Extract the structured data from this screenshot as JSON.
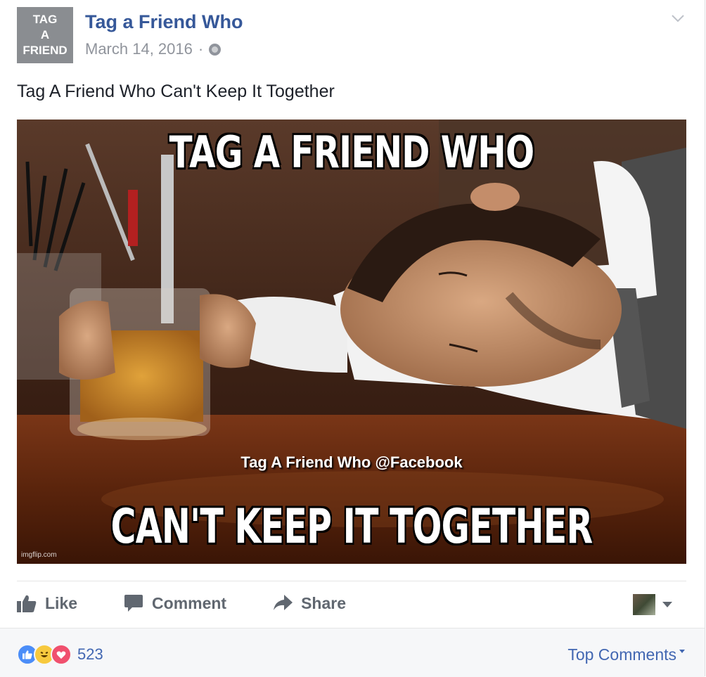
{
  "post": {
    "avatar_lines": [
      "TAG",
      "A",
      "FRIEND"
    ],
    "page_name": "Tag a Friend Who",
    "date": "March 14, 2016",
    "separator": "·",
    "privacy_icon": "globe-icon",
    "text": "Tag A Friend Who Can't Keep It Together"
  },
  "photo": {
    "top_text": "TAG A FRIEND WHO",
    "middle_text": "Tag A Friend Who @Facebook",
    "bottom_text": "CAN'T KEEP IT TOGETHER",
    "credit": "imgflip.com"
  },
  "actions": {
    "like": "Like",
    "comment": "Comment",
    "share": "Share"
  },
  "footer": {
    "reaction_icons": [
      "like-reaction-icon",
      "haha-reaction-icon",
      "love-reaction-icon"
    ],
    "reaction_count": "523",
    "sort_label": "Top Comments"
  },
  "colors": {
    "link_blue": "#365899",
    "action_gray": "#606770",
    "footer_bg": "#f6f7f9",
    "like_blue": "#4b8df8",
    "haha_yellow": "#f7c93e",
    "love_red": "#f0506e"
  }
}
